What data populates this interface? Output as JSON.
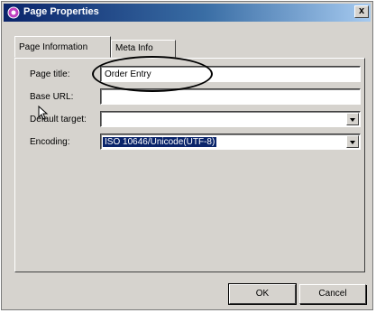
{
  "window": {
    "title": "Page Properties",
    "close_glyph": "x"
  },
  "tabs": [
    {
      "label": "Page Information",
      "active": true
    },
    {
      "label": "Meta Info",
      "active": false
    }
  ],
  "form": {
    "page_title": {
      "label": "Page title:",
      "value": "Order Entry"
    },
    "base_url": {
      "label": "Base URL:",
      "value": ""
    },
    "default_target": {
      "label": "Default target:",
      "value": ""
    },
    "encoding": {
      "label": "Encoding:",
      "value": "ISO 10646/Unicode(UTF-8)"
    }
  },
  "buttons": {
    "ok": "OK",
    "cancel": "Cancel"
  },
  "colors": {
    "titlebar_start": "#0a246a",
    "selection": "#0a246a",
    "dialog_bg": "#d6d3ce"
  },
  "icons": [
    "page-properties-icon",
    "close-icon",
    "dropdown-arrow-icon",
    "mouse-cursor-icon"
  ]
}
